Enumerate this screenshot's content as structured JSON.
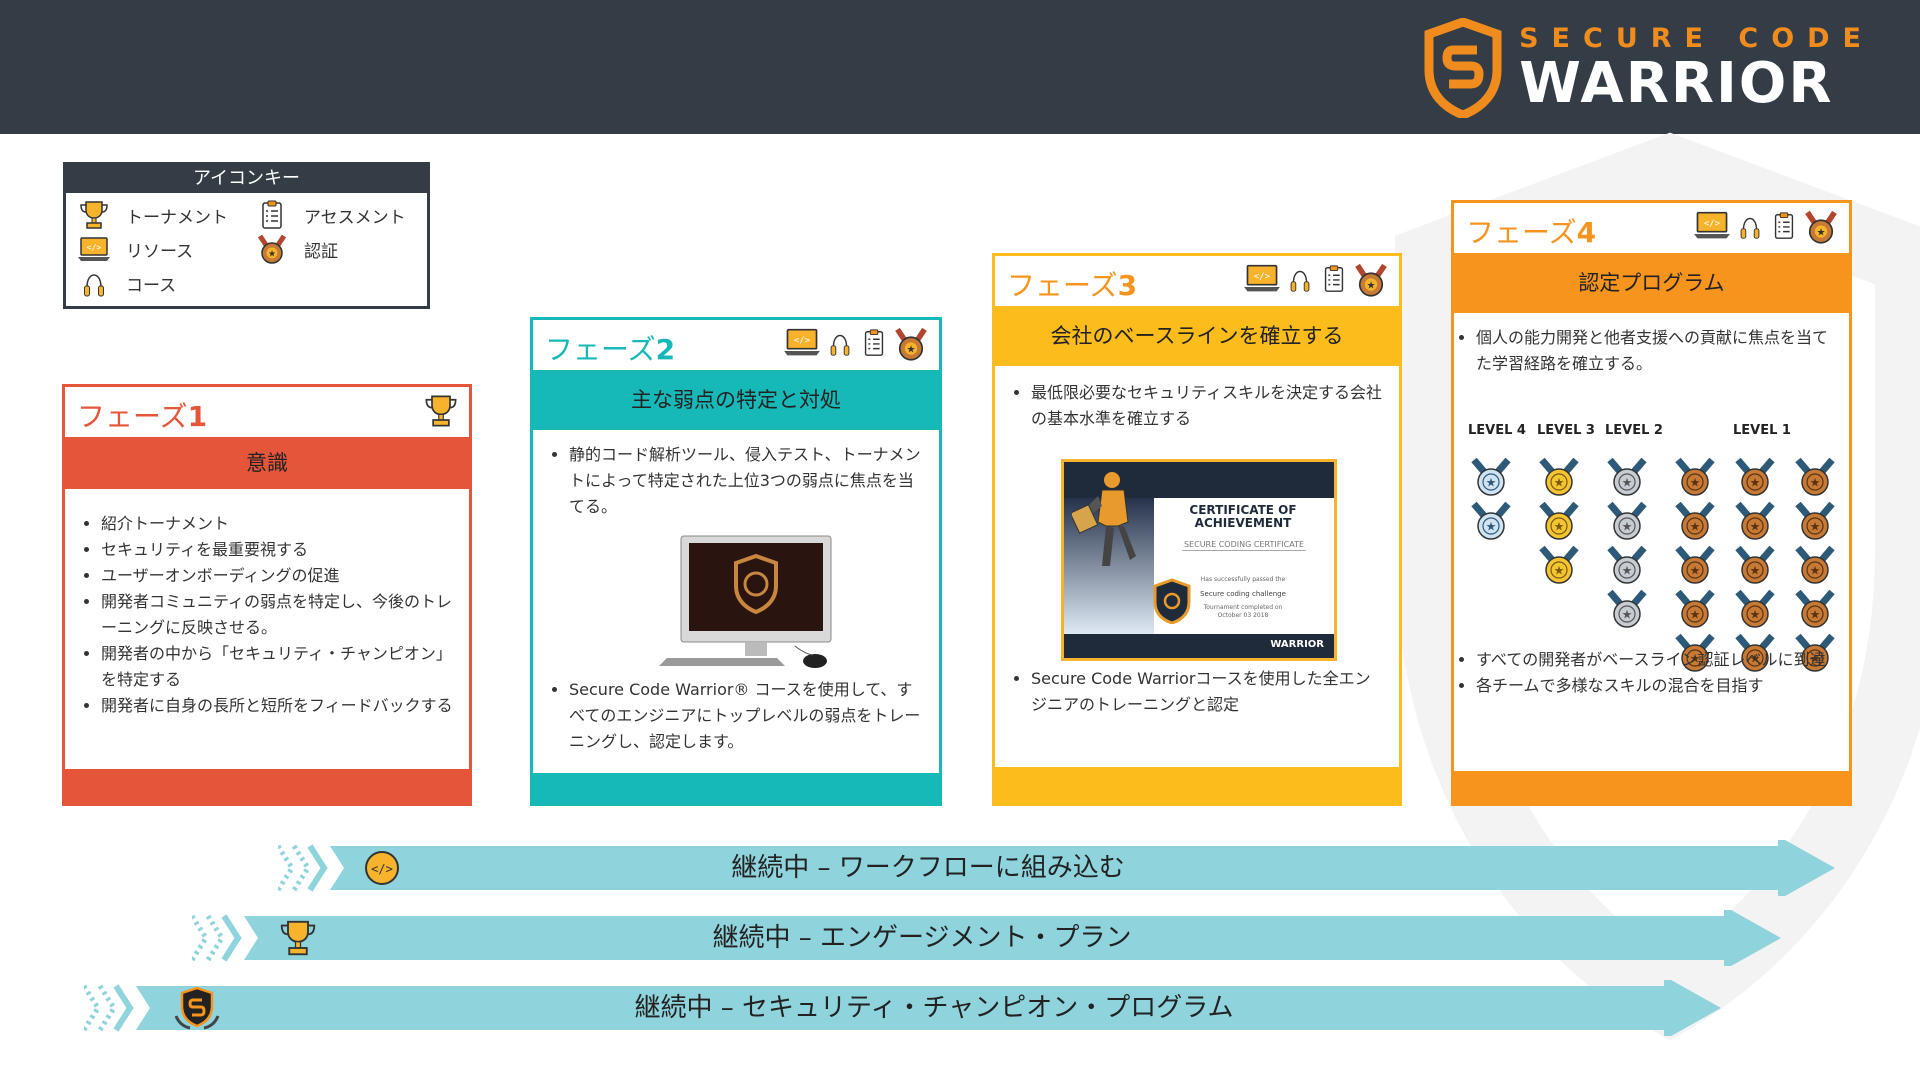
{
  "header": {
    "brand_line1": "SECURE CODE",
    "brand_line2": "WARRIOR"
  },
  "key": {
    "title": "アイコンキー",
    "items": [
      {
        "label": "トーナメント",
        "icon": "trophy-icon"
      },
      {
        "label": "アセスメント",
        "icon": "clipboard-icon"
      },
      {
        "label": "リソース",
        "icon": "laptop-icon"
      },
      {
        "label": "認証",
        "icon": "medal-icon"
      },
      {
        "label": "コース",
        "icon": "jump-rope-icon"
      }
    ]
  },
  "phases": [
    {
      "label_prefix": "フェーズ",
      "number": "1",
      "title": "意識",
      "color": "#e4553a",
      "bullets": [
        "紹介トーナメント",
        "セキュリティを最重要視する",
        "ユーザーオンボーディングの促進",
        "開発者コミュニティの弱点を特定し、今後のトレーニングに反映させる。",
        "開発者の中から「セキュリティ・チャンピオン」を特定する",
        "開発者に自身の長所と短所をフィードバックする"
      ]
    },
    {
      "label_prefix": "フェーズ",
      "number": "2",
      "title": "主な弱点の特定と対処",
      "color": "#17b9b8",
      "bullets": [
        "静的コード解析ツール、侵入テスト、トーナメントによって特定された上位3つの弱点に焦点を当てる。",
        "Secure Code Warrior® コースを使用して、すべてのエンジニアにトップレベルの弱点をトレーニングし、認定します。"
      ]
    },
    {
      "label_prefix": "フェーズ",
      "number": "3",
      "title": "会社のベースラインを確立する",
      "color": "#fbbc1c",
      "bullets": [
        "最低限必要なセキュリティスキルを決定する会社の基本水準を確立する",
        "Secure Code Warriorコースを使用した全エンジニアのトレーニングと認定"
      ],
      "certificate": {
        "title": "CERTIFICATE OF ACHIEVEMENT",
        "subtitle": "SECURE CODING CERTIFICATE",
        "line1": "Has successfully passed the",
        "line2": "Secure coding challenge",
        "line3": "Tournament completed on",
        "line4": "October 03 2018",
        "brand": "WARRIOR"
      }
    },
    {
      "label_prefix": "フェーズ",
      "number": "4",
      "title": "認定プログラム",
      "color": "#f7941d",
      "bullets_top": [
        "個人の能力開発と他者支援への貢献に焦点を当てた学習経路を確立する。"
      ],
      "bullets_bottom": [
        "すべての開発者がベースライン認証レベルに到達",
        "各チームで多様なスキルの混合を目指す"
      ],
      "levels": [
        "LEVEL 4",
        "LEVEL 3",
        "LEVEL 2",
        "LEVEL 1"
      ]
    }
  ],
  "ongoing": [
    {
      "label": "継続中 – ワークフローに組み込む",
      "icon": "code-icon"
    },
    {
      "label": "継続中 – エンゲージメント・プラン",
      "icon": "trophy-icon"
    },
    {
      "label": "継続中 – セキュリティ・チャンピオン・プログラム",
      "icon": "shield-icon"
    }
  ],
  "colors": {
    "header_bg": "#343d46",
    "brand_orange": "#f08c1e",
    "arrow_fill": "#8fd3dc"
  }
}
